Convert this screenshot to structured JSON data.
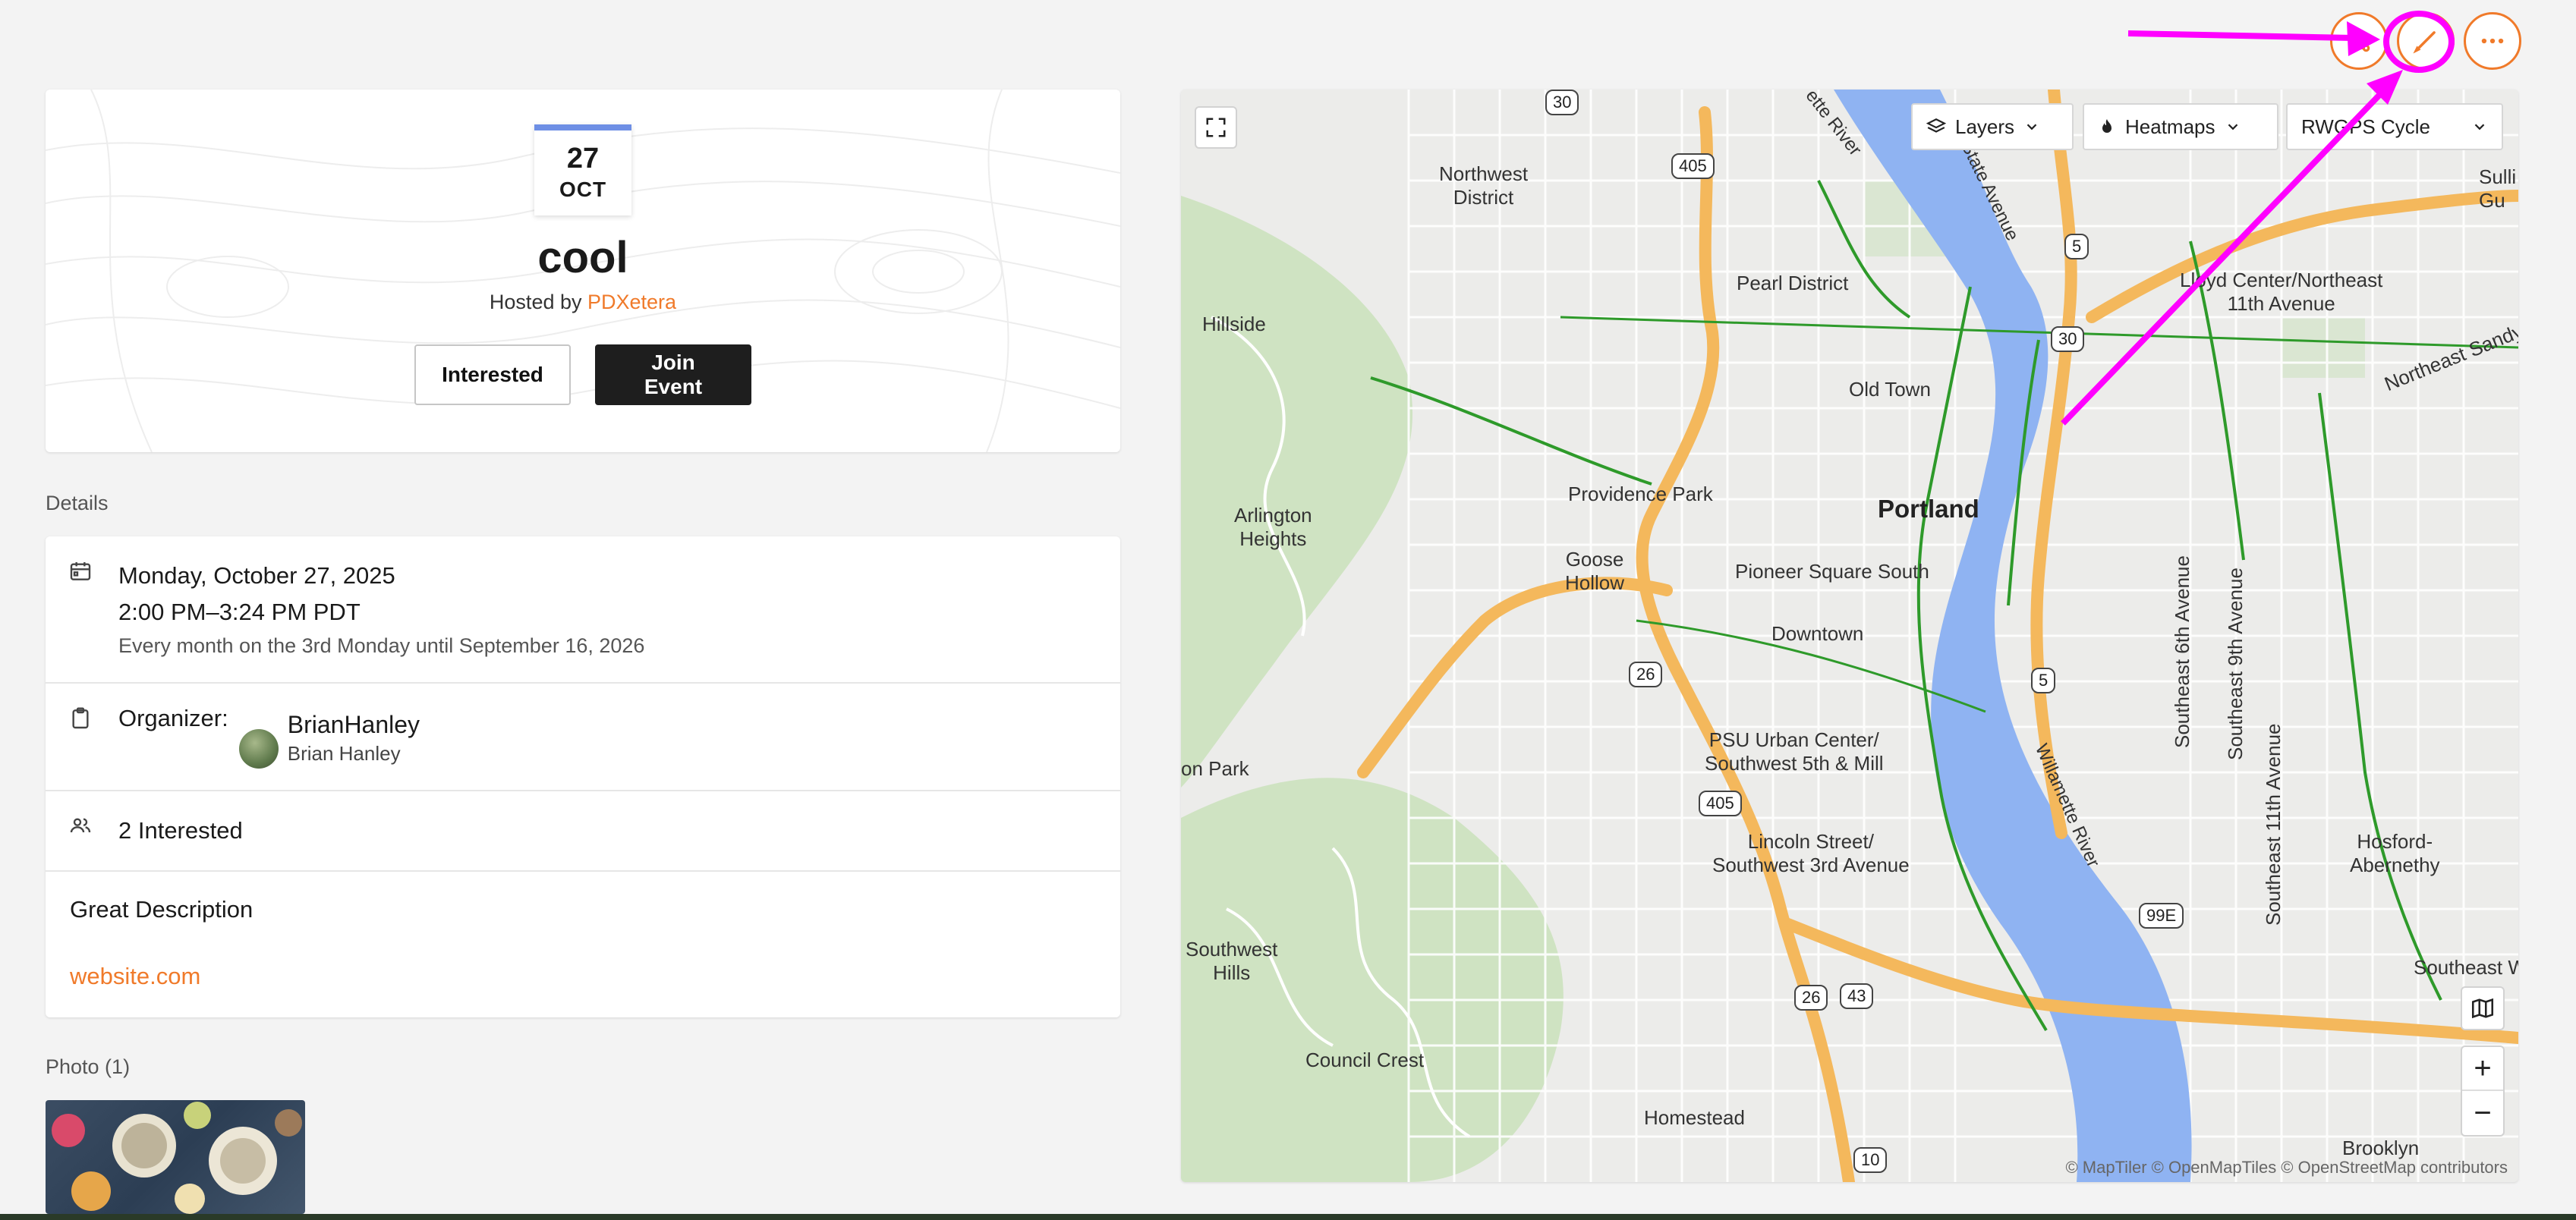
{
  "event": {
    "day": "27",
    "month": "OCT",
    "title": "cool",
    "hosted_prefix": "Hosted by ",
    "host": "PDXetera",
    "interested_label": "Interested",
    "join_label": "Join Event"
  },
  "details": {
    "section_label": "Details",
    "date": "Monday, October 27, 2025",
    "time": "2:00 PM–3:24 PM PDT",
    "recurrence": "Every month on the 3rd Monday until September 16, 2026",
    "organizer_label": "Organizer:",
    "organizer_name": "BrianHanley",
    "organizer_username": "Brian Hanley",
    "interested_count": "2 Interested",
    "description": "Great Description",
    "website": "website.com"
  },
  "photos": {
    "label": "Photo (1)"
  },
  "map": {
    "layers_label": "Layers",
    "heatmaps_label": "Heatmaps",
    "basemap_label": "RWGPS Cycle",
    "attribution": "© MapTiler © OpenMapTiles © OpenStreetMap contributors",
    "zoom_in": "+",
    "zoom_out": "−",
    "places": {
      "northwest_district": "Northwest\nDistrict",
      "pearl": "Pearl District",
      "old_town": "Old Town",
      "hillside": "Hillside",
      "providence": "Providence Park",
      "portland": "Portland",
      "arlington": "Arlington\nHeights",
      "goose": "Goose\nHollow",
      "pioneer": "Pioneer Square South",
      "downtown": "Downtown",
      "psu": "PSU Urban Center/\nSouthwest 5th & Mill",
      "lincoln": "Lincoln Street/\nSouthwest 3rd Avenue",
      "lloyd": "Lloyd Center/Northeast\n11th Avenue",
      "ne_sandy": "Northeast Sandy",
      "sullivan": "Sulli\nGu",
      "se6": "Southeast 6th Avenue",
      "se9": "Southeast 9th Avenue",
      "se11": "Southeast 11th Avenue",
      "hosford": "Hosford-\nAbernethy",
      "sw_hills": "Southwest\nHills",
      "council": "Council Crest",
      "homestead": "Homestead",
      "brooklyn": "Brooklyn",
      "se_wo": "Southeast Wo",
      "willamette": "Willamette River",
      "ette_river": "ette River",
      "state_ave": "State Avenue",
      "on_park": "on Park"
    },
    "shields": {
      "s30a": "30",
      "s405a": "405",
      "s5a": "5",
      "s30b": "30",
      "s26a": "26",
      "s5b": "5",
      "s405b": "405",
      "s99e": "99E",
      "s26b": "26",
      "s43": "43",
      "s10": "10"
    }
  },
  "icons": {
    "route": "route-icon",
    "edit": "pencil-icon",
    "more": "more-horizontal-icon"
  },
  "colors": {
    "accent": "#f07a2a",
    "highlight": "#ff00ff",
    "date_bar": "#6e8fe5",
    "river": "#8fb3f2",
    "highway": "#f4b85c",
    "bike_path": "#2e9a2a"
  }
}
